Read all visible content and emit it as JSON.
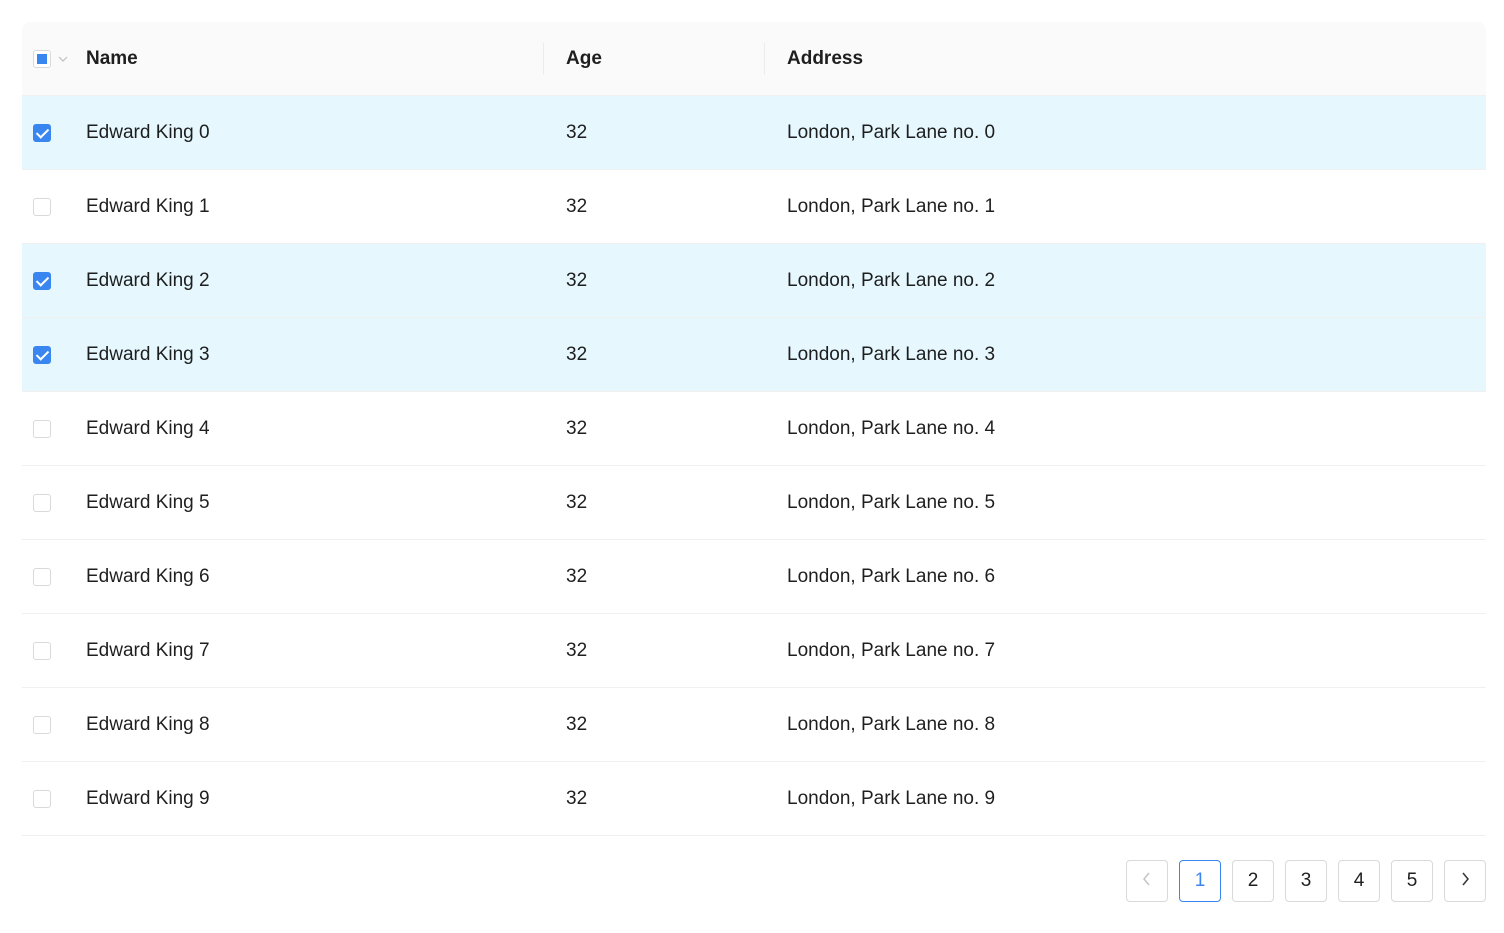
{
  "table": {
    "columns": {
      "name": "Name",
      "age": "Age",
      "address": "Address"
    },
    "header_selection": "indeterminate",
    "rows": [
      {
        "name": "Edward King 0",
        "age": "32",
        "address": "London, Park Lane no. 0",
        "selected": true
      },
      {
        "name": "Edward King 1",
        "age": "32",
        "address": "London, Park Lane no. 1",
        "selected": false
      },
      {
        "name": "Edward King 2",
        "age": "32",
        "address": "London, Park Lane no. 2",
        "selected": true
      },
      {
        "name": "Edward King 3",
        "age": "32",
        "address": "London, Park Lane no. 3",
        "selected": true
      },
      {
        "name": "Edward King 4",
        "age": "32",
        "address": "London, Park Lane no. 4",
        "selected": false
      },
      {
        "name": "Edward King 5",
        "age": "32",
        "address": "London, Park Lane no. 5",
        "selected": false
      },
      {
        "name": "Edward King 6",
        "age": "32",
        "address": "London, Park Lane no. 6",
        "selected": false
      },
      {
        "name": "Edward King 7",
        "age": "32",
        "address": "London, Park Lane no. 7",
        "selected": false
      },
      {
        "name": "Edward King 8",
        "age": "32",
        "address": "London, Park Lane no. 8",
        "selected": false
      },
      {
        "name": "Edward King 9",
        "age": "32",
        "address": "London, Park Lane no. 9",
        "selected": false
      }
    ]
  },
  "pagination": {
    "prev_icon": "chevron-left-icon",
    "next_icon": "chevron-right-icon",
    "pages": [
      "1",
      "2",
      "3",
      "4",
      "5"
    ],
    "current": "1"
  },
  "colors": {
    "accent": "#3a86f0",
    "selected_row": "#e6f7fd",
    "header_bg": "#fafafa"
  }
}
